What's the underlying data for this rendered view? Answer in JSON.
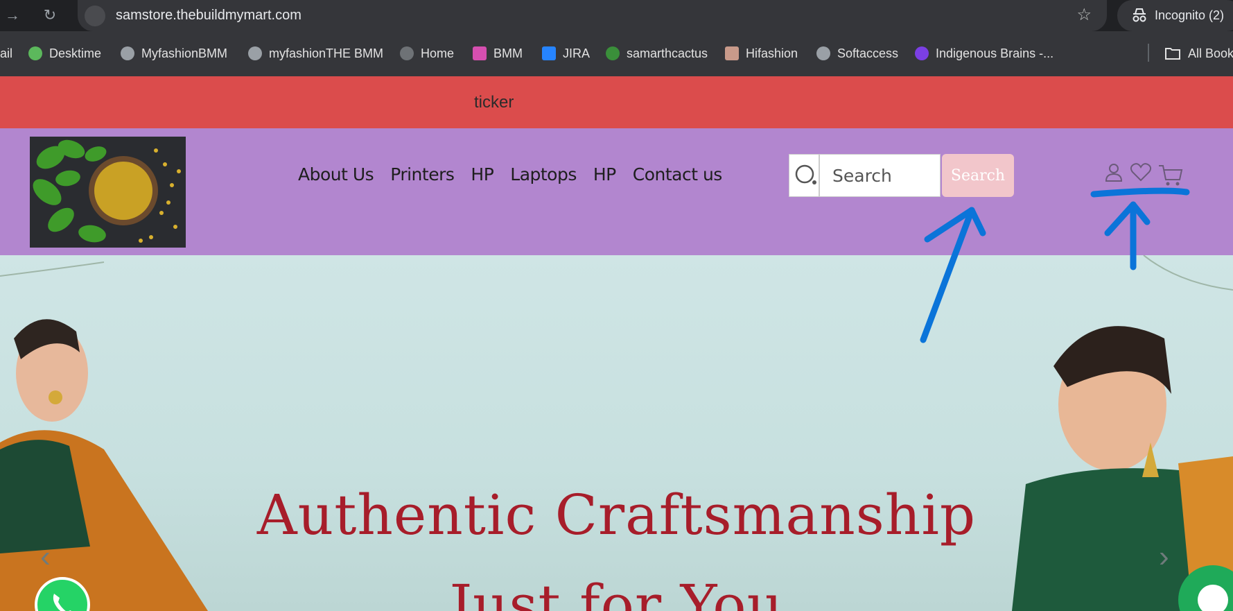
{
  "browser": {
    "url": "samstore.thebuildmymart.com",
    "incognito_label": "Incognito (2)",
    "bookmarks": [
      {
        "label": "ail",
        "icon": "mail-icon"
      },
      {
        "label": "Desktime",
        "icon": "desktime-icon"
      },
      {
        "label": "MyfashionBMM",
        "icon": "globe-icon"
      },
      {
        "label": "myfashionTHE BMM",
        "icon": "globe-icon"
      },
      {
        "label": "Home",
        "icon": "globe-icon"
      },
      {
        "label": "BMM",
        "icon": "bmm-icon"
      },
      {
        "label": "JIRA",
        "icon": "jira-icon"
      },
      {
        "label": "samarthcactus",
        "icon": "cactus-icon"
      },
      {
        "label": "Hifashion",
        "icon": "hifashion-icon"
      },
      {
        "label": "Softaccess",
        "icon": "globe-icon"
      },
      {
        "label": "Indigenous Brains -...",
        "icon": "indigenous-icon"
      }
    ],
    "all_bookmarks_label": "All Book"
  },
  "ticker": {
    "text": "ticker"
  },
  "header": {
    "nav": [
      "About Us",
      "Printers",
      "HP",
      "Laptops",
      "HP",
      "Contact us"
    ],
    "search_placeholder": "Search",
    "search_button": "Search",
    "icons": [
      "user-icon",
      "heart-icon",
      "cart-icon"
    ]
  },
  "hero": {
    "title_line1": "Authentic Craftsmanship",
    "title_line2": "Just for You"
  },
  "colors": {
    "ticker_bg": "#db4c4c",
    "header_bg": "#b286cf",
    "search_button_bg": "#f2c6cb",
    "hero_title": "#a71d2a",
    "annotation": "#0b74d9"
  }
}
